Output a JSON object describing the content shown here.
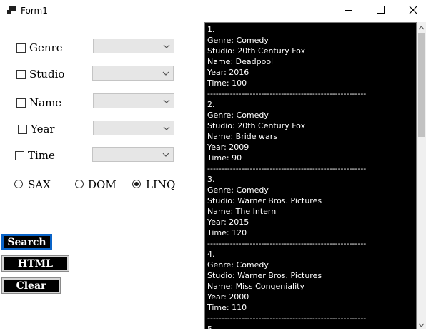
{
  "window": {
    "title": "Form1"
  },
  "filters": {
    "genre": {
      "label": "Genre",
      "value": ""
    },
    "studio": {
      "label": "Studio",
      "value": ""
    },
    "name": {
      "label": "Name",
      "value": ""
    },
    "year": {
      "label": "Year",
      "value": ""
    },
    "time": {
      "label": "Time",
      "value": ""
    }
  },
  "parser_options": {
    "sax": {
      "label": "SAX",
      "selected": false
    },
    "dom": {
      "label": "DOM",
      "selected": false
    },
    "linq": {
      "label": "LINQ",
      "selected": true
    }
  },
  "buttons": {
    "search": "Search",
    "html": "HTML",
    "clear": "Clear"
  },
  "output": {
    "text": "1.\nGenre: Comedy\nStudio: 20th Century Fox\nName: Deadpool\nYear: 2016\nTime: 100\n--------------------------------------------------------\n2.\nGenre: Comedy\nStudio: 20th Century Fox\nName: Bride wars\nYear: 2009\nTime: 90\n--------------------------------------------------------\n3.\nGenre: Comedy\nStudio: Warner Bros. Pictures\nName: The Intern\nYear: 2015\nTime: 120\n--------------------------------------------------------\n4.\nGenre: Comedy\nStudio: Warner Bros. Pictures\nName: Miss Congeniality\nYear: 2000\nTime: 110\n--------------------------------------------------------\n5."
  },
  "colors": {
    "output_bg": "#000000",
    "output_fg": "#ffffff",
    "button_bg": "#000000",
    "focus": "#0a64c8"
  }
}
